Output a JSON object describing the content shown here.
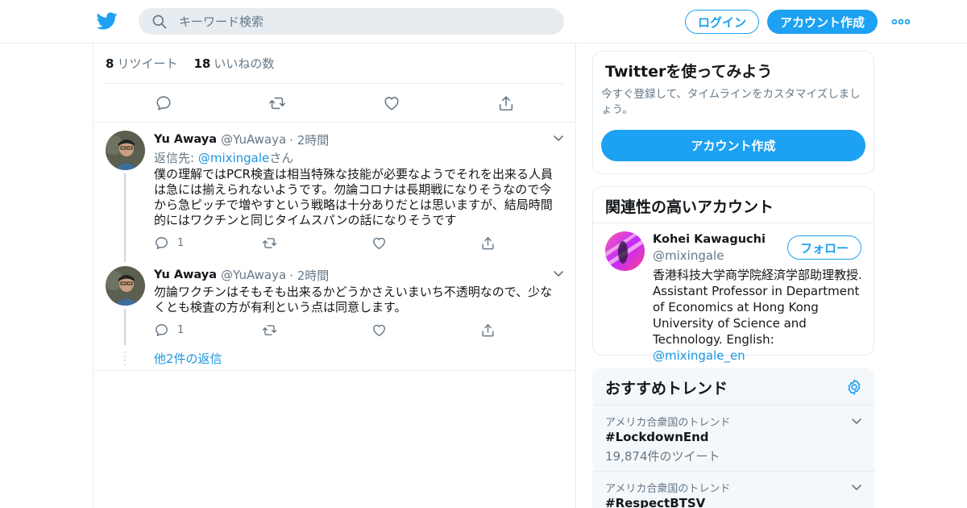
{
  "header": {
    "search_placeholder": "キーワード検索",
    "login_label": "ログイン",
    "signup_label": "アカウント作成"
  },
  "tweet_stats": {
    "retweets_count": "8",
    "retweets_label": "リツイート",
    "likes_count": "18",
    "likes_label": "いいねの数"
  },
  "replies": [
    {
      "name": "Yu Awaya",
      "handle": "@YuAwaya",
      "time": "· 2時間",
      "reply_to_prefix": "返信先: ",
      "reply_to_handle": "@mixingale",
      "reply_to_suffix": "さん",
      "text": "僕の理解ではPCR検査は相当特殊な技能が必要なようでそれを出来る人員は急には揃えられないようです。勿論コロナは長期戦になりそうなので今から急ピッチで増やすという戦略は十分ありだとは思いますが、結局時間的にはワクチンと同じタイムスパンの話になりそうです",
      "reply_count": "1"
    },
    {
      "name": "Yu Awaya",
      "handle": "@YuAwaya",
      "time": "· 2時間",
      "text": "勿論ワクチンはそもそも出来るかどうかさえいまいち不透明なので、少なくとも検査の方が有利という点は同意します。",
      "reply_count": "1"
    }
  ],
  "more_replies": "他2件の返信",
  "signup_card": {
    "title": "Twitterを使ってみよう",
    "subtitle": "今すぐ登録して、タイムラインをカスタマイズしましょう。",
    "button": "アカウント作成"
  },
  "relevant": {
    "title": "関連性の高いアカウント",
    "name": "Kohei Kawaguchi",
    "handle": "@mixingale",
    "follow_label": "フォロー",
    "bio": "香港科技大学商学院経済学部助理教授. Assistant Professor in Department of Economics at Hong Kong University of Science and Technology. English: ",
    "bio_link": "@mixingale_en"
  },
  "trends": {
    "title": "おすすめトレンド",
    "items": [
      {
        "location": "アメリカ合衆国のトレンド",
        "tag": "#LockdownEnd",
        "count": "19,874件のツイート"
      },
      {
        "location": "アメリカ合衆国のトレンド",
        "tag": "#RespectBTSV",
        "count": ""
      }
    ]
  },
  "colors": {
    "accent": "#1da1f2",
    "link": "#1b95e0",
    "muted": "#657786",
    "border": "#e6ecf0"
  },
  "icons": [
    "twitter-bird-icon",
    "search-icon",
    "more-dots-icon",
    "reply-icon",
    "retweet-icon",
    "like-icon",
    "share-icon",
    "chevron-down-icon",
    "gear-icon"
  ]
}
